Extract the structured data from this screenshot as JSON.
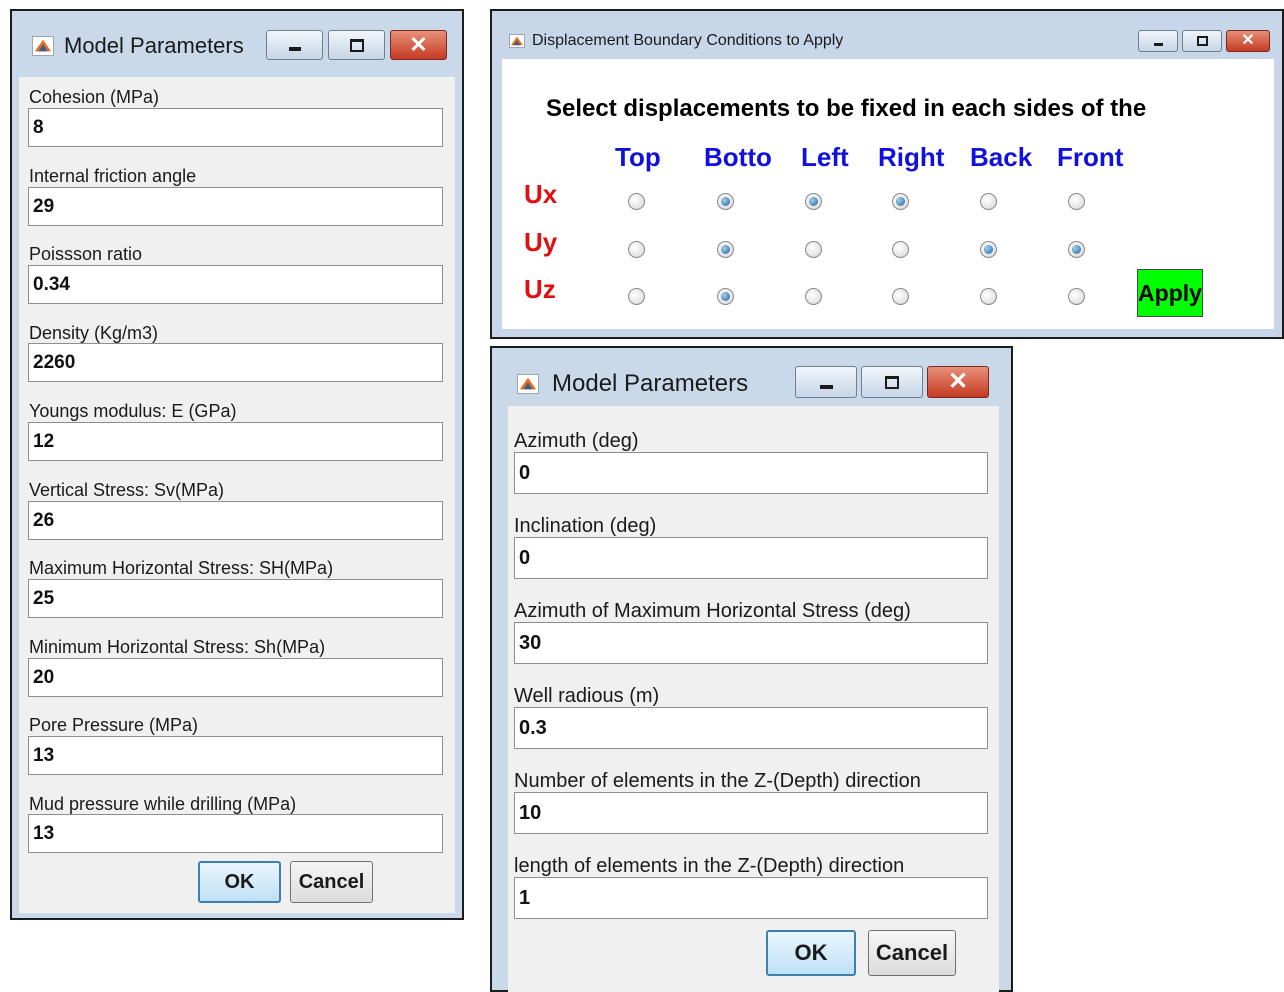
{
  "window1": {
    "title": "Model Parameters",
    "fields": [
      {
        "label": "Cohesion (MPa)",
        "value": "8"
      },
      {
        "label": "Internal friction angle",
        "value": "29"
      },
      {
        "label": "Poissson ratio",
        "value": "0.34"
      },
      {
        "label": "Density (Kg/m3)",
        "value": "2260"
      },
      {
        "label": "Youngs modulus: E (GPa)",
        "value": "12"
      },
      {
        "label": "Vertical Stress: Sv(MPa)",
        "value": "26"
      },
      {
        "label": "Maximum Horizontal Stress: SH(MPa)",
        "value": "25"
      },
      {
        "label": "Minimum Horizontal Stress: Sh(MPa)",
        "value": "20"
      },
      {
        "label": "Pore Pressure (MPa)",
        "value": "13"
      },
      {
        "label": "Mud pressure while drilling (MPa)",
        "value": "13"
      }
    ],
    "ok_label": "OK",
    "cancel_label": "Cancel"
  },
  "window2": {
    "title": "Displacement Boundary Conditions to Apply",
    "heading": "Select displacements to be fixed in each sides of the",
    "columns": [
      "Top",
      "Botto",
      "Left",
      "Right",
      "Back",
      "Front"
    ],
    "rows": [
      {
        "label": "Ux",
        "selected": [
          false,
          true,
          true,
          true,
          false,
          false
        ]
      },
      {
        "label": "Uy",
        "selected": [
          false,
          true,
          false,
          false,
          true,
          true
        ]
      },
      {
        "label": "Uz",
        "selected": [
          false,
          true,
          false,
          false,
          false,
          false
        ]
      }
    ],
    "apply_label": "Apply",
    "apply_color": "#00ff00"
  },
  "window3": {
    "title": "Model Parameters",
    "fields": [
      {
        "label": "Azimuth (deg)",
        "value": "0"
      },
      {
        "label": "Inclination (deg)",
        "value": "0"
      },
      {
        "label": "Azimuth of Maximum Horizontal Stress (deg)",
        "value": "30"
      },
      {
        "label": "Well radious (m)",
        "value": "0.3"
      },
      {
        "label": "Number of elements in the Z-(Depth) direction",
        "value": "10"
      },
      {
        "label": "length of elements in the Z-(Depth) direction",
        "value": "1"
      }
    ],
    "ok_label": "OK",
    "cancel_label": "Cancel"
  },
  "icons": {
    "app": "matlab-icon",
    "minimize": "minimize-icon",
    "maximize": "maximize-icon",
    "close": "close-icon"
  }
}
